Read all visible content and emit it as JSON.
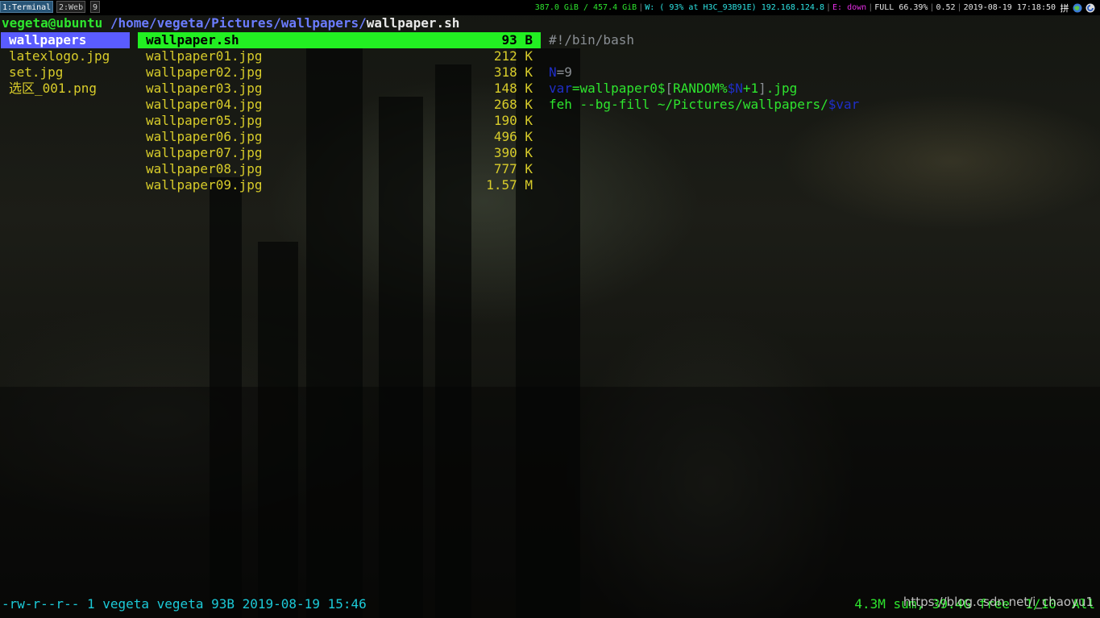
{
  "bar": {
    "workspaces": [
      {
        "label": "1:Terminal",
        "active": true
      },
      {
        "label": "2:Web",
        "active": false
      },
      {
        "label": "9",
        "active": false
      }
    ],
    "status": {
      "disk": "387.0 GiB / 457.4 GiB",
      "wifi": "W: ( 93% at H3C_93B91E) 192.168.124.8",
      "ethernet": "E: down",
      "battery": "FULL 66.39%",
      "load": "0.52",
      "datetime": "2019-08-19 17:18:50",
      "ime_icon": "pinyin-input-icon",
      "tray_icons": [
        "network-globe-icon",
        "update-manager-icon"
      ]
    },
    "colors": {
      "disk": "#2ee52e",
      "wifi": "#2ee5e5",
      "ethernet": "#e52ee5",
      "battery": "#2ee52e",
      "load": "#2ee52e",
      "datetime": "#2ee52e"
    }
  },
  "terminal": {
    "title": {
      "user_host": "vegeta@ubuntu",
      "path": "/home/vegeta/Pictures/wallpapers/",
      "file": "wallpaper.sh"
    },
    "parent_column": [
      {
        "name": "wallpapers",
        "selected": true
      },
      {
        "name": "latexlogo.jpg",
        "selected": false
      },
      {
        "name": "set.jpg",
        "selected": false
      },
      {
        "name": "选区_001.png",
        "selected": false
      }
    ],
    "main_column": [
      {
        "name": "wallpaper.sh",
        "size": "93 B",
        "selected": true
      },
      {
        "name": "wallpaper01.jpg",
        "size": "212 K",
        "selected": false
      },
      {
        "name": "wallpaper02.jpg",
        "size": "318 K",
        "selected": false
      },
      {
        "name": "wallpaper03.jpg",
        "size": "148 K",
        "selected": false
      },
      {
        "name": "wallpaper04.jpg",
        "size": "268 K",
        "selected": false
      },
      {
        "name": "wallpaper05.jpg",
        "size": "190 K",
        "selected": false
      },
      {
        "name": "wallpaper06.jpg",
        "size": "496 K",
        "selected": false
      },
      {
        "name": "wallpaper07.jpg",
        "size": "390 K",
        "selected": false
      },
      {
        "name": "wallpaper08.jpg",
        "size": "777 K",
        "selected": false
      },
      {
        "name": "wallpaper09.jpg",
        "size": "1.57 M",
        "selected": false
      }
    ],
    "preview": {
      "shebang": "#!/bin/bash",
      "line2_var": "N",
      "line2_rest": "=9",
      "line3_var": "var",
      "line3_eq_val": "=wallpaper0$",
      "line3_bracket_open": "[",
      "line3_random": "RANDOM%",
      "line3_n": "$N",
      "line3_plus": "+1",
      "line3_bracket_close": "]",
      "line3_ext": ".jpg",
      "line4_cmd": "feh --bg-fill ~/Pictures/wallpapers/",
      "line4_var": "$var"
    },
    "status_left": "-rw-r--r-- 1 vegeta vegeta 93B 2019-08-19 15:46",
    "status_right": "4.3M sum, 39.4G free  1/10  All",
    "watermark": "https://blog.csdn.net/i_chaoyu1"
  }
}
